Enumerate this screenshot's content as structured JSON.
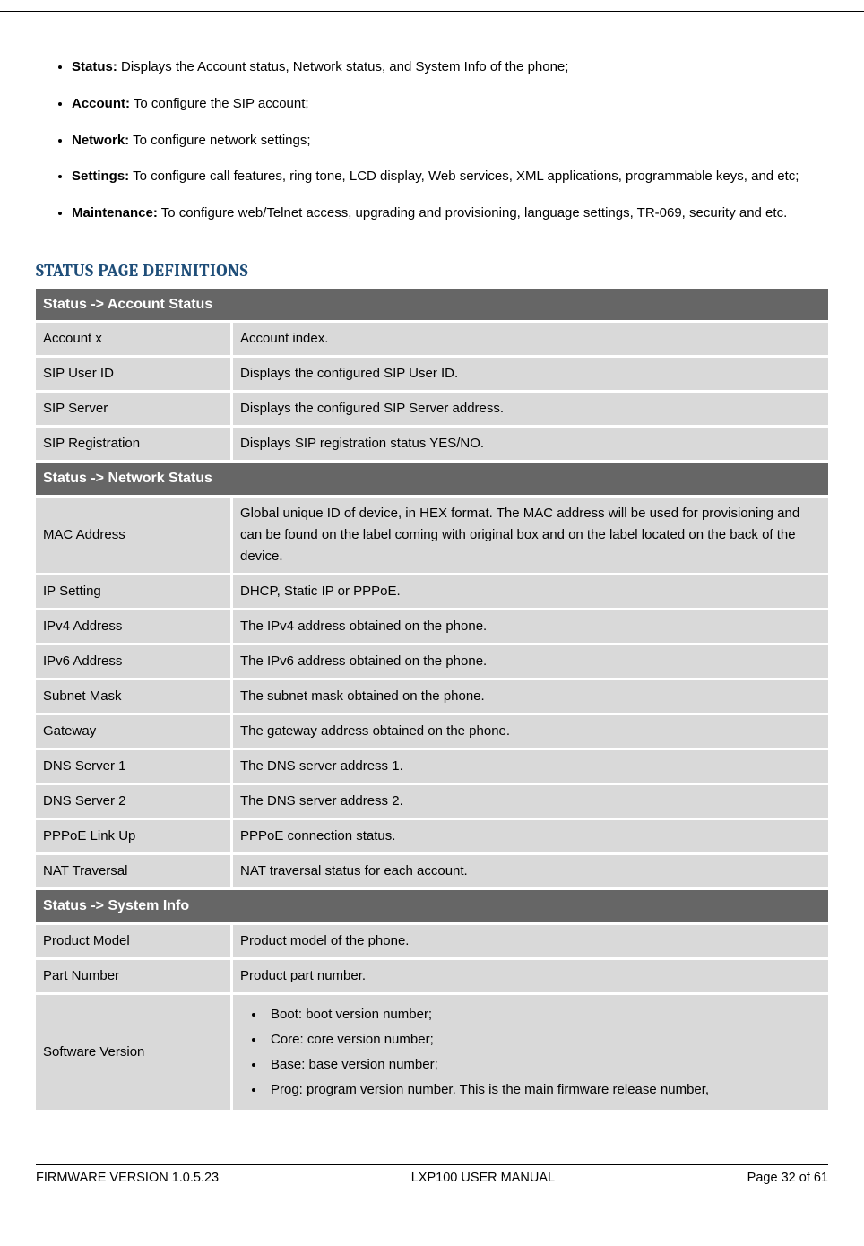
{
  "main_bullets": [
    {
      "label": "Status:",
      "text": " Displays the Account status, Network status, and System Info of the phone;",
      "justify": false
    },
    {
      "label": "Account:",
      "text": " To configure the SIP account;",
      "justify": false
    },
    {
      "label": "Network:",
      "text": " To configure network settings;",
      "justify": false
    },
    {
      "label": "Settings:",
      "text": " To configure call features, ring tone, LCD display, Web services, XML applications, programmable keys, and etc;",
      "justify": true
    },
    {
      "label": "Maintenance:",
      "text": " To configure web/Telnet access, upgrading and provisioning, language settings, TR-069, security and etc.",
      "justify": true
    }
  ],
  "section_title": "STATUS PAGE DEFINITIONS",
  "table": {
    "sections": [
      {
        "header": "Status -> Account Status",
        "rows": [
          {
            "l": "Account x",
            "r": "Account index."
          },
          {
            "l": "SIP User ID",
            "r": "Displays the configured SIP User ID."
          },
          {
            "l": "SIP Server",
            "r": "Displays the configured SIP Server address."
          },
          {
            "l": "SIP Registration",
            "r": "Displays SIP registration status YES/NO."
          }
        ]
      },
      {
        "header": "Status -> Network Status",
        "rows": [
          {
            "l": "MAC Address",
            "r": "Global unique ID of device, in HEX format. The MAC address will be used for provisioning and can be found on the label coming with original box and on the label located on the back of the device."
          },
          {
            "l": "IP Setting",
            "r": "DHCP, Static IP or PPPoE."
          },
          {
            "l": "IPv4 Address",
            "r": "The IPv4 address obtained on the phone."
          },
          {
            "l": "IPv6 Address",
            "r": "The IPv6 address obtained on the phone."
          },
          {
            "l": "Subnet Mask",
            "r": "The subnet mask obtained on the phone."
          },
          {
            "l": "Gateway",
            "r": "The gateway address obtained on the phone."
          },
          {
            "l": "DNS Server 1",
            "r": "The DNS server address 1."
          },
          {
            "l": "DNS Server 2",
            "r": "The DNS server address 2."
          },
          {
            "l": "PPPoE Link Up",
            "r": "PPPoE connection status."
          },
          {
            "l": "NAT Traversal",
            "r": "NAT traversal status for each account."
          }
        ]
      },
      {
        "header": "Status -> System Info",
        "rows": [
          {
            "l": "Product Model",
            "r": "Product model of the phone."
          },
          {
            "l": "Part Number",
            "r": "Product part number."
          },
          {
            "l": "Software Version",
            "r_list": [
              "Boot: boot version number;",
              "Core: core version number;",
              "Base: base version number;",
              "Prog: program version number. This is the main firmware release number,"
            ]
          }
        ]
      }
    ]
  },
  "footer": {
    "left": "FIRMWARE VERSION 1.0.5.23",
    "center": "LXP100 USER MANUAL",
    "right": "Page 32 of 61"
  }
}
